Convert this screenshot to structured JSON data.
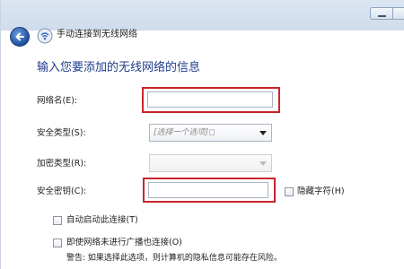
{
  "header": {
    "title": "手动连接到无线网络"
  },
  "main": {
    "heading": "输入您要添加的无线网络的信息"
  },
  "form": {
    "network_name_label": "网络名(E):",
    "network_name_value": "",
    "security_type_label": "安全类型(S):",
    "security_type_value": "[选择一个选项]◻",
    "encryption_type_label": "加密类型(R):",
    "encryption_type_value": "",
    "security_key_label": "安全密钥(C):",
    "security_key_value": "",
    "hide_chars_label": "隐藏字符(H)",
    "auto_start_label": "自动启动此连接(T)",
    "connect_hidden_label": "即使网络未进行广播也连接(O)",
    "warning_text": "警告: 如果选择此选项，则计算机的隐私信息可能存在风险。"
  },
  "icons": {
    "back": "back-arrow-icon",
    "network": "wireless-network-icon"
  },
  "colors": {
    "heading": "#1e3d8a",
    "highlight": "#c8252c",
    "back_button": "#1f4f9c"
  }
}
